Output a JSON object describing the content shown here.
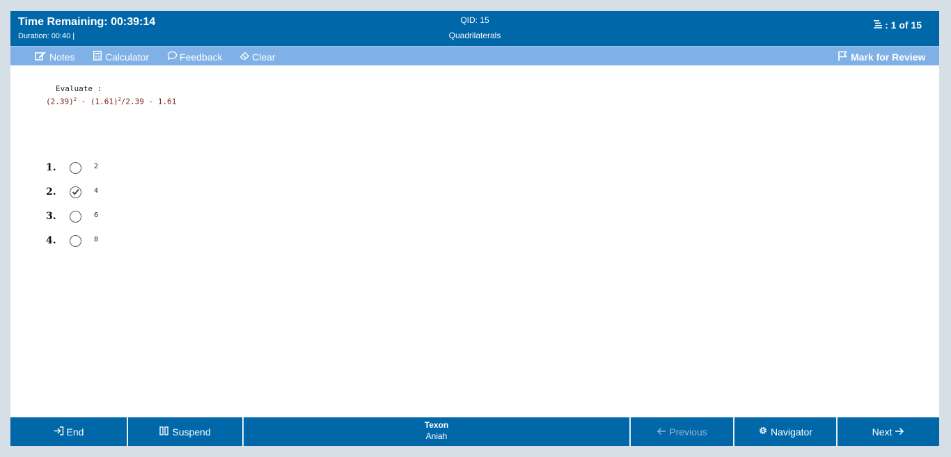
{
  "header": {
    "timer_label": "Time Remaining: 00:39:14",
    "duration": "Duration: 00:40 |",
    "qid": "QID: 15",
    "topic": "Quadrilaterals",
    "progress": ": 1 of 15"
  },
  "toolbar": {
    "notes": "Notes",
    "calculator": "Calculator",
    "feedback": "Feedback",
    "clear": "Clear",
    "mark_review": "Mark for Review"
  },
  "question": {
    "label": "Evaluate :",
    "expr_a": "(2.39)",
    "exp_a": "2",
    "expr_b": " - (1.61)",
    "exp_b": "2",
    "expr_c": "/2.39 - 1.61"
  },
  "options": [
    {
      "num": "1.",
      "text": "2",
      "selected": false
    },
    {
      "num": "2.",
      "text": "4",
      "selected": true
    },
    {
      "num": "3.",
      "text": "6",
      "selected": false
    },
    {
      "num": "4.",
      "text": "8",
      "selected": false
    }
  ],
  "footer": {
    "end": "End",
    "suspend": "Suspend",
    "exam_name": "Texon",
    "user_name": "Aniah",
    "previous": "Previous",
    "navigator": "Navigator",
    "next": "Next"
  },
  "colors": {
    "header_bg": "#0067a8",
    "toolbar_bg": "#7fb0e6",
    "expression_text": "#7a1a1a"
  }
}
